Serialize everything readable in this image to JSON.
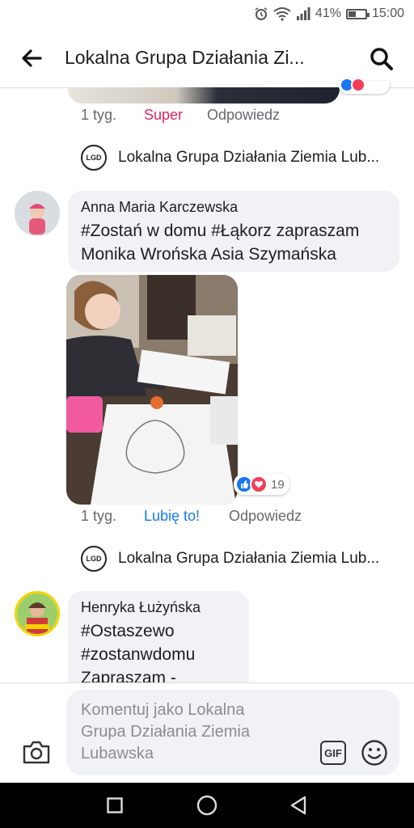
{
  "status_bar": {
    "battery": "41%",
    "time": "15:00",
    "battery_level": 0.41
  },
  "header": {
    "title": "Lokalna Grupa Działania Zi..."
  },
  "prev_comment_meta": {
    "time": "1 tyg.",
    "reaction": "Super",
    "reply": "Odpowiedz"
  },
  "page_reply_1": {
    "name": "Lokalna Grupa Działania Ziemia Lub..."
  },
  "comment_1": {
    "author": "Anna Maria Karczewska",
    "line1_tag1": "#Zostań",
    "line1_text1": " w domu ",
    "line1_tag2": "#Łąkorz",
    "line1_text2": " zapraszam",
    "line2": "Monika Wrońska Asia Szymańska",
    "reactions_count": "19",
    "time": "1 tyg.",
    "like": "Lubię to!",
    "reply": "Odpowiedz"
  },
  "page_reply_2": {
    "name": "Lokalna Grupa Działania Ziemia Lub..."
  },
  "comment_2": {
    "author": "Henryka Łużyńska",
    "line1": "#Ostaszewo",
    "line2": "#zostanwdomu",
    "line3": "Zapraszam -"
  },
  "composer": {
    "placeholder_line1": "Komentuj jako Lokalna",
    "placeholder_line2": "Grupa Działania Ziemia",
    "placeholder_line3": "Lubawska",
    "gif_label": "GIF"
  },
  "logo_text": "LGD",
  "colors": {
    "super": "#e0245e",
    "like": "#1877f2",
    "muted": "#65676b",
    "bubble": "#f0f2f5"
  }
}
